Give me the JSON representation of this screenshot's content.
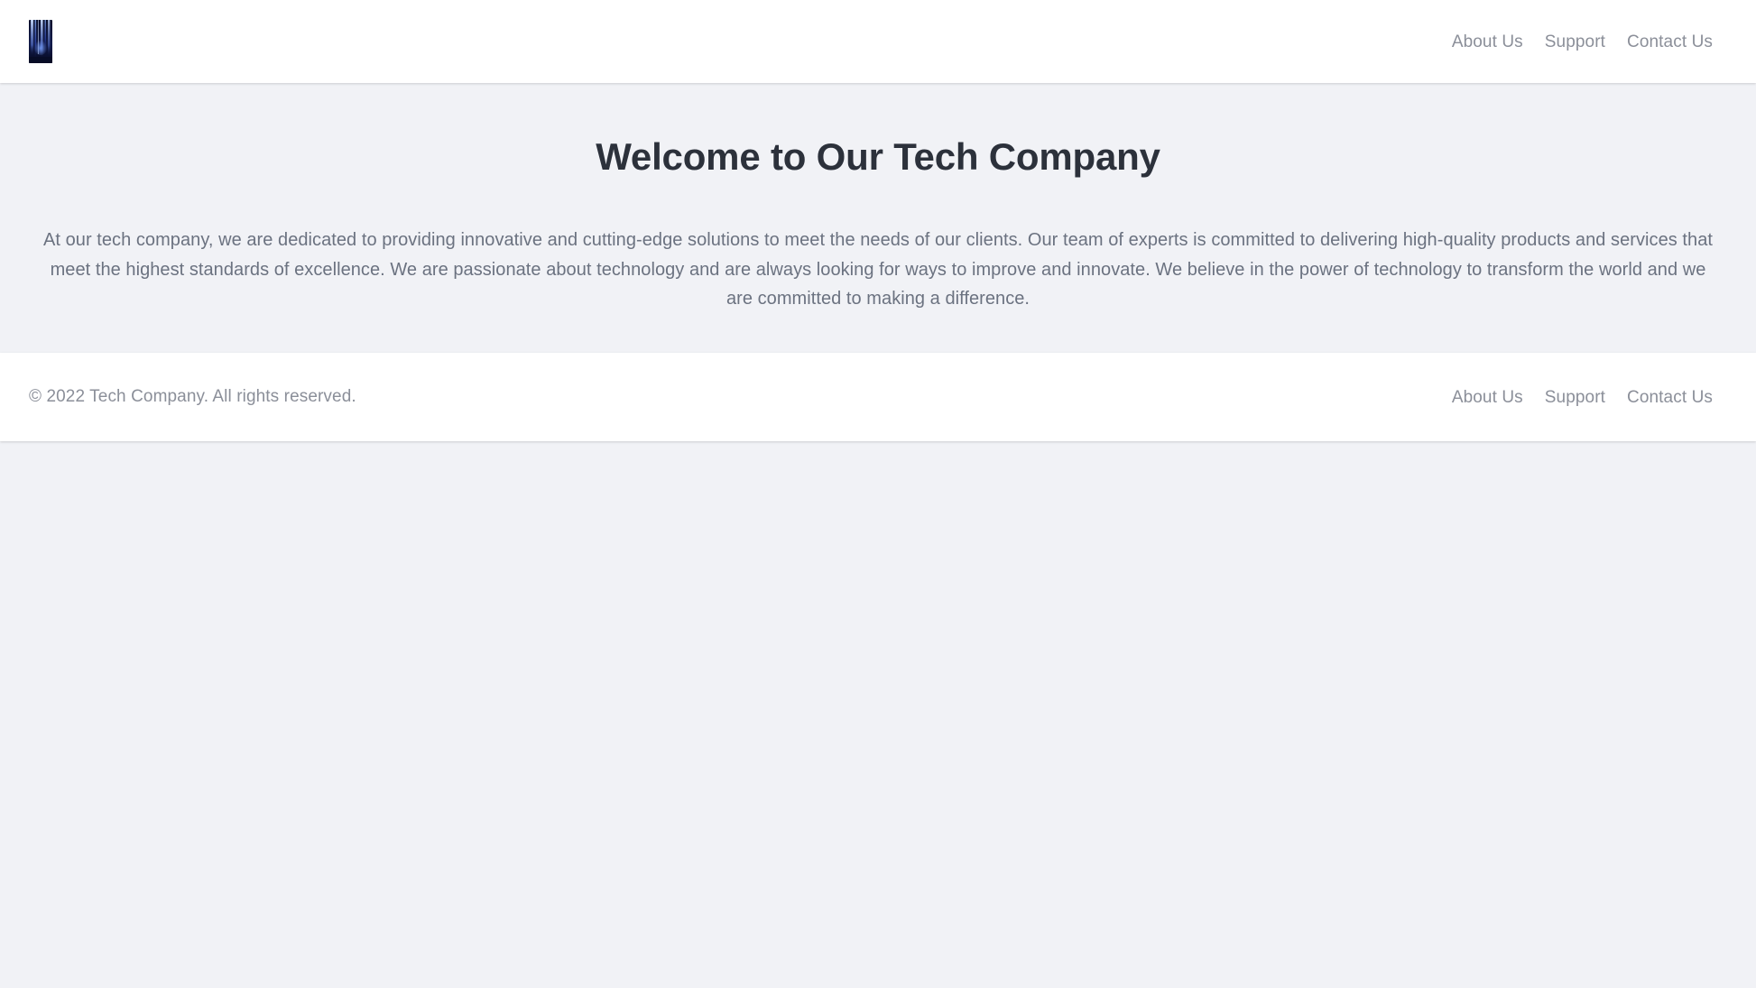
{
  "header": {
    "logo": {
      "icon": "company-logo-image",
      "alt": "Tech Company logo",
      "description": "dark navy image with vertical blue light streaks"
    },
    "nav": [
      {
        "label": "About Us"
      },
      {
        "label": "Support"
      },
      {
        "label": "Contact Us"
      }
    ]
  },
  "main": {
    "title": "Welcome to Our Tech Company",
    "paragraph": "At our tech company, we are dedicated to providing innovative and cutting-edge solutions to meet the needs of our clients. Our team of experts is committed to delivering high-quality products and services that meet the highest standards of excellence. We are passionate about technology and are always looking for ways to improve and innovate. We believe in the power of technology to transform the world and we are committed to making a difference."
  },
  "footer": {
    "copyright": "© 2022 Tech Company. All rights reserved.",
    "nav": [
      {
        "label": "About Us"
      },
      {
        "label": "Support"
      },
      {
        "label": "Contact Us"
      }
    ]
  },
  "colors": {
    "page_background": "#f1f2f6",
    "surface": "#ffffff",
    "heading_text": "#2c313b",
    "body_text": "#6b7280",
    "muted_text": "#8b8f99",
    "logo_dark": "#0b1030",
    "logo_accent": "#3b5bdb"
  }
}
